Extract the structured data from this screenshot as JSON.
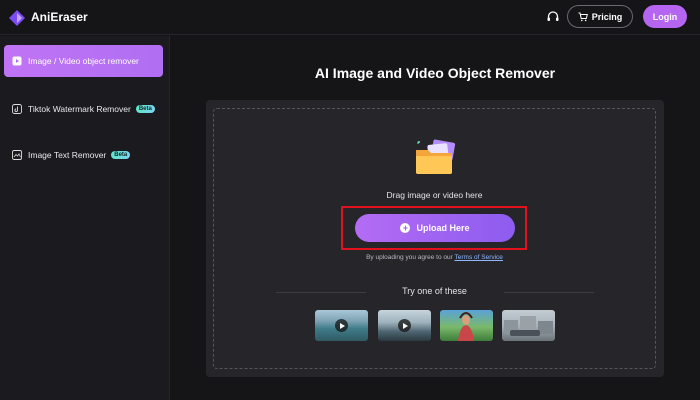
{
  "header": {
    "brand": "AniEraser",
    "pricing_label": "Pricing",
    "login_label": "Login",
    "icons": [
      "logo-icon",
      "headset-icon",
      "cart-icon"
    ]
  },
  "sidebar": {
    "items": [
      {
        "label": "Image / Video object remover",
        "active": true,
        "icon": "play-square-icon"
      },
      {
        "label": "Tiktok Watermark Remover",
        "badge": "Beta",
        "icon": "tiktok-icon"
      },
      {
        "label": "Image Text Remover",
        "badge": "Beta",
        "icon": "image-text-icon"
      }
    ]
  },
  "main": {
    "title": "AI Image and Video Object Remover",
    "drag_text": "Drag image or video here",
    "upload_label": "Upload Here",
    "agree_prefix": "By uploading you agree to our",
    "terms_link": "Terms of Service",
    "try_label": "Try one of these",
    "samples": [
      {
        "kind": "video",
        "icon": "play-icon"
      },
      {
        "kind": "video",
        "icon": "play-icon"
      },
      {
        "kind": "image"
      },
      {
        "kind": "image"
      }
    ]
  },
  "colors": {
    "accent": "#b565ef",
    "background": "#151417",
    "panel": "#26252a",
    "highlight_box": "#e0121e"
  }
}
